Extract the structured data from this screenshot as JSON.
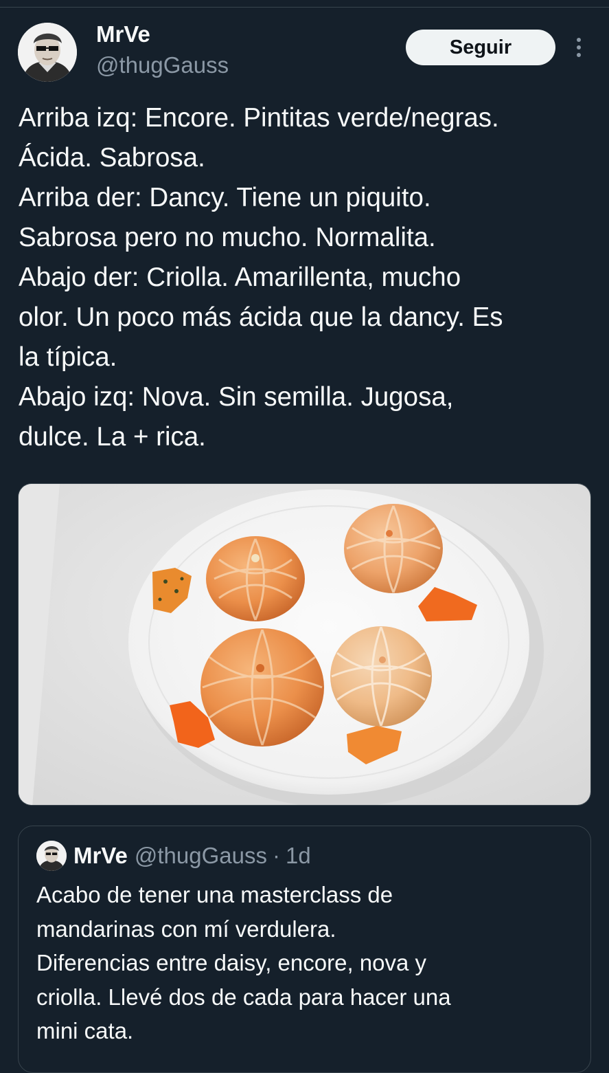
{
  "tweet": {
    "author": {
      "display_name": "MrVe",
      "handle": "@thugGauss",
      "avatar_icon": "avatar-portrait-sunglasses-icon"
    },
    "follow_label": "Seguir",
    "more_icon": "more-options-icon",
    "text": "Arriba izq: Encore. Pintitas verde/negras.\nÁcida. Sabrosa.\nArriba der: Dancy. Tiene un piquito.\nSabrosa pero no mucho. Normalita.\nAbajo der: Criolla. Amarillenta, mucho\nolor. Un poco más ácida que la dancy. Es\nla típica.\nAbajo izq: Nova. Sin semilla. Jugosa,\ndulce. La + rica."
  },
  "quoted_tweet": {
    "display_name": "MrVe",
    "handle": "@thugGauss",
    "separator": "·",
    "time": "1d",
    "text": "Acabo de tener una masterclass de\nmandarinas con mí verdulera.\nDiferencias entre daisy, encore, nova y\ncriolla. Llevé dos de cada para hacer una\nmini cata."
  },
  "colors": {
    "background": "#15202b",
    "text_primary": "#f7f9f9",
    "text_secondary": "#8b98a5",
    "border": "#38444d",
    "follow_button_bg": "#eff3f4"
  }
}
